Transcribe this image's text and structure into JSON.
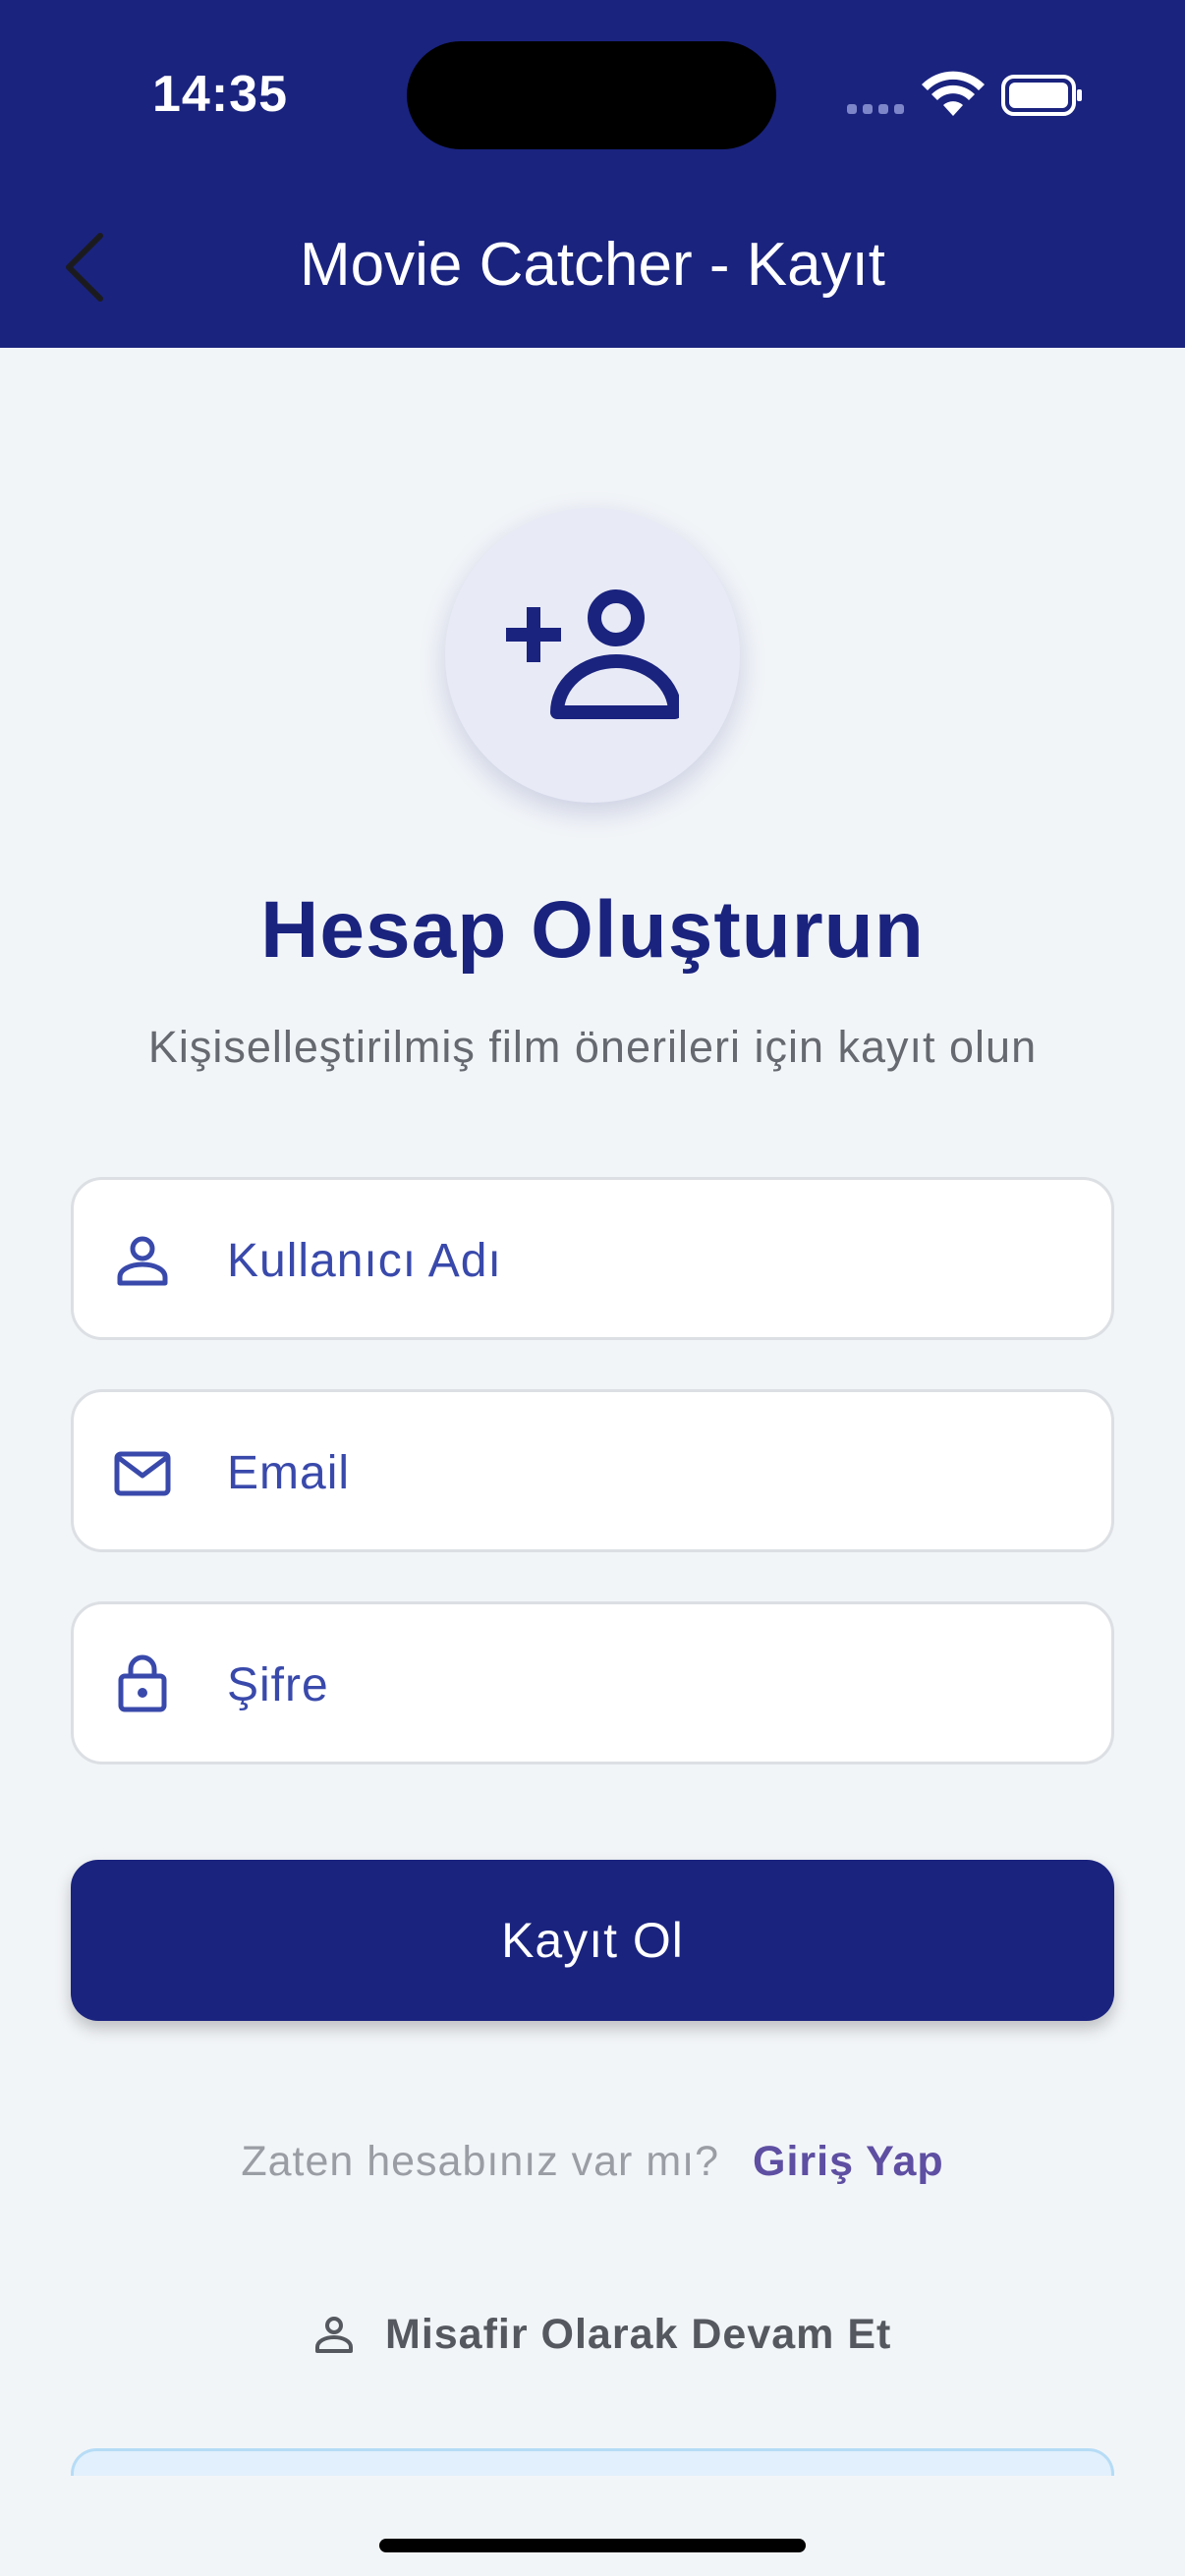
{
  "status_bar": {
    "time": "14:35",
    "icons": [
      "cellular-icon",
      "wifi-icon",
      "battery-icon"
    ]
  },
  "nav": {
    "back_icon": "chevron-left-icon",
    "title": "Movie Catcher - Kayıt"
  },
  "hero": {
    "icon": "person-add-icon",
    "heading": "Hesap Oluşturun",
    "subheading": "Kişiselleştirilmiş film önerileri için kayıt olun"
  },
  "form": {
    "username": {
      "icon": "person-icon",
      "placeholder": "Kullanıcı Adı"
    },
    "email": {
      "icon": "mail-icon",
      "placeholder": "Email"
    },
    "password": {
      "icon": "lock-icon",
      "placeholder": "Şifre"
    },
    "submit_label": "Kayıt Ol"
  },
  "login": {
    "question": "Zaten hesabınız var mı?",
    "link_label": "Giriş Yap"
  },
  "guest": {
    "icon": "person-icon",
    "label": "Misafir Olarak Devam Et"
  },
  "colors": {
    "primary": "#1a237e",
    "accent": "#3949ab",
    "background": "#f2f5f8",
    "link": "#5e4fa2"
  }
}
